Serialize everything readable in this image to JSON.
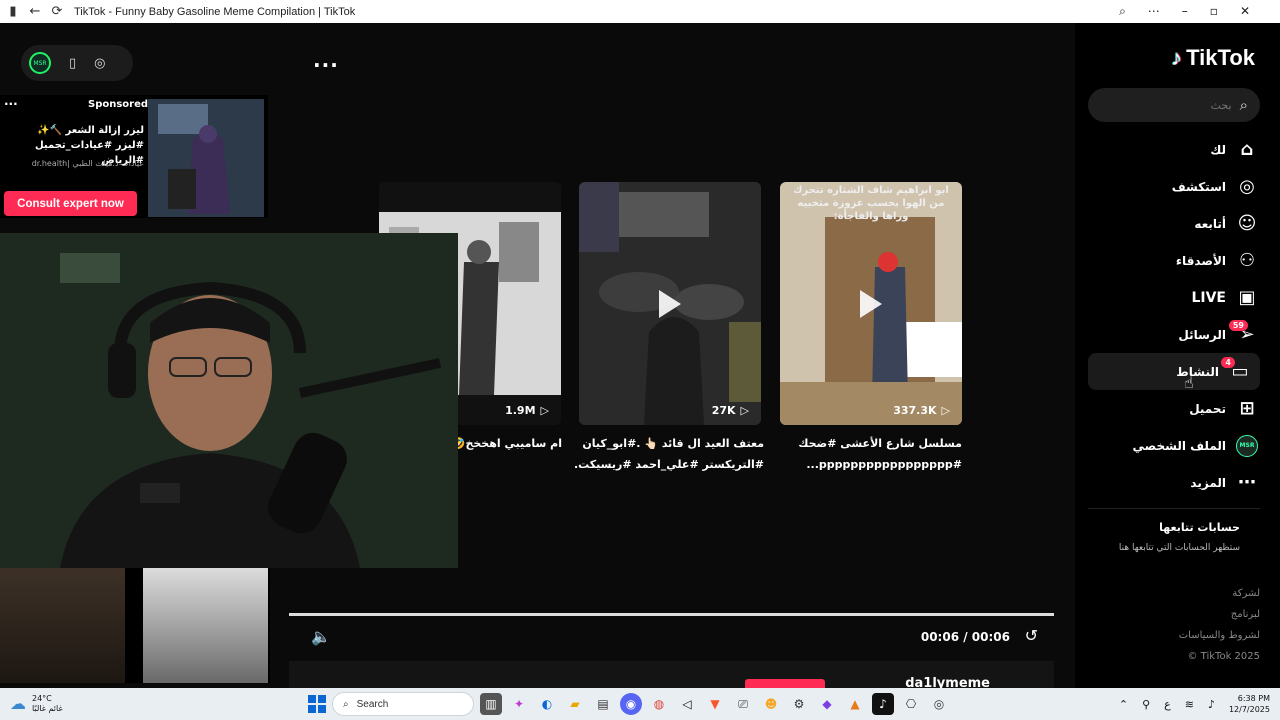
{
  "window": {
    "title": "TikTok - Funny Baby Gasoline Meme Compilation | TikTok"
  },
  "sidebar": {
    "logo_text": "TikTok",
    "search_placeholder": "بحث",
    "items": [
      {
        "label": "لك",
        "icon": "home-icon"
      },
      {
        "label": "استكشف",
        "icon": "compass-icon"
      },
      {
        "label": "أتابعه",
        "icon": "user-follow-icon"
      },
      {
        "label": "الأصدقاء",
        "icon": "friends-icon"
      },
      {
        "label": "LIVE",
        "icon": "live-tv-icon"
      },
      {
        "label": "الرسائل",
        "icon": "send-icon",
        "badge": "59"
      },
      {
        "label": "النشاط",
        "icon": "activity-icon",
        "badge": "4"
      },
      {
        "label": "تحميل",
        "icon": "upload-plus-icon"
      },
      {
        "label": "الملف الشخصي",
        "icon": "avatar"
      },
      {
        "label": "المزيد",
        "icon": "more-dots-icon"
      }
    ],
    "following_title": "حسابات تتابعها",
    "following_sub": "ستظهر الحسابات التي تتابعها هنا",
    "footer": [
      "لشركة",
      "لبرنامج",
      "لشروط والسياسات",
      "TikTok 2025 ©"
    ]
  },
  "ad": {
    "sponsored": "Sponsored",
    "text": "ليزر إزالة الشعر 🔨✨ #ليزر #عيادات_تجميل #الرياض",
    "sub": "عيادات د.هيلث الطبي |dr.health",
    "cta": "Consult expert now"
  },
  "cards": [
    {
      "count": "1.9M",
      "caption_l1": "ام ساميبي اهخخخ🤣🤣",
      "caption_l2": ""
    },
    {
      "count": "27K",
      "caption_l1": "معتف العيد ال قائد 👆🏻 .#ابو_كيان",
      "caption_l2": "#التريكستر #علي_احمد #ريسيكت..."
    },
    {
      "count": "337.3K",
      "caption_l1": "مسلسل شارع الأعشى #ضحك",
      "caption_l2": "#ppppppppppppppppp...",
      "overlay": "ابو ابراهيم شاف الشتاره تتحرك من الهوا بحسب عزوزة متخبيه وراها والفاجأة:"
    }
  ],
  "player": {
    "time": "00:06 / 00:06",
    "progress": 1.0,
    "username": "da1lymeme"
  },
  "taskbar": {
    "temp": "24°C",
    "weather_text": "غائم غالبًا",
    "search": "Search",
    "time": "6:38 PM",
    "date": "12/7/2025",
    "lang": "ع"
  }
}
